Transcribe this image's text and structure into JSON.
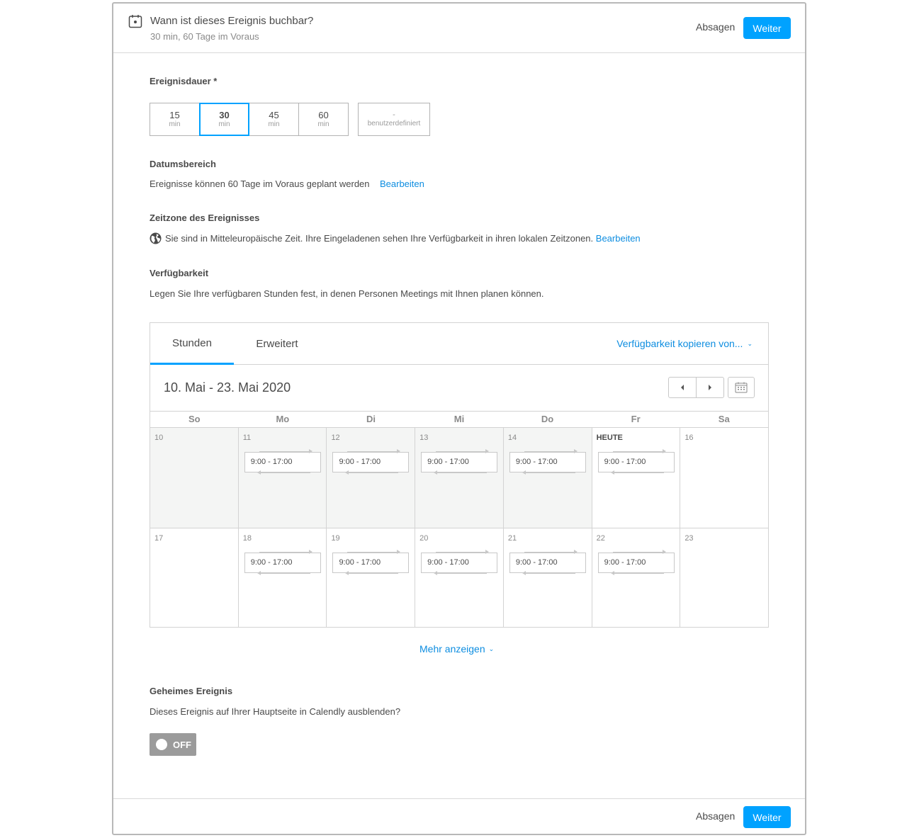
{
  "header": {
    "title": "Wann ist dieses Ereignis buchbar?",
    "subtitle": "30 min, 60 Tage im Voraus",
    "cancel_label": "Absagen",
    "next_label": "Weiter"
  },
  "duration": {
    "label": "Ereignisdauer *",
    "options": [
      {
        "value": "15",
        "unit": "min"
      },
      {
        "value": "30",
        "unit": "min"
      },
      {
        "value": "45",
        "unit": "min"
      },
      {
        "value": "60",
        "unit": "min"
      }
    ],
    "selected": "30",
    "custom": {
      "value": "-",
      "unit": "benutzerdefiniert"
    }
  },
  "date_range": {
    "label": "Datumsbereich",
    "text": "Ereignisse können 60 Tage im Voraus geplant werden",
    "edit_label": "Bearbeiten"
  },
  "timezone": {
    "label": "Zeitzone des Ereignisses",
    "text": "Sie sind in Mitteleuropäische Zeit. Ihre Eingeladenen sehen Ihre Verfügbarkeit in ihren lokalen Zeitzonen.",
    "edit_label": "Bearbeiten",
    "icon": "globe-icon"
  },
  "availability": {
    "label": "Verfügbarkeit",
    "text": "Legen Sie Ihre verfügbaren Stunden fest, in denen Personen Meetings mit Ihnen planen können."
  },
  "calendar": {
    "tabs": [
      "Stunden",
      "Erweitert"
    ],
    "active_tab": "Stunden",
    "copy_label": "Verfügbarkeit kopieren von...",
    "range": "10. Mai - 23. Mai 2020",
    "weekdays": [
      "So",
      "Mo",
      "Di",
      "Mi",
      "Do",
      "Fr",
      "Sa"
    ],
    "weeks": [
      [
        {
          "num": "10",
          "past": true,
          "slot": ""
        },
        {
          "num": "11",
          "past": true,
          "slot": "9:00 - 17:00"
        },
        {
          "num": "12",
          "past": true,
          "slot": "9:00 - 17:00"
        },
        {
          "num": "13",
          "past": true,
          "slot": "9:00 - 17:00"
        },
        {
          "num": "14",
          "past": true,
          "slot": "9:00 - 17:00"
        },
        {
          "num": "HEUTE",
          "past": false,
          "today": true,
          "slot": "9:00 - 17:00"
        },
        {
          "num": "16",
          "past": false,
          "slot": ""
        }
      ],
      [
        {
          "num": "17",
          "past": false,
          "slot": ""
        },
        {
          "num": "18",
          "past": false,
          "slot": "9:00 - 17:00"
        },
        {
          "num": "19",
          "past": false,
          "slot": "9:00 - 17:00"
        },
        {
          "num": "20",
          "past": false,
          "slot": "9:00 - 17:00"
        },
        {
          "num": "21",
          "past": false,
          "slot": "9:00 - 17:00"
        },
        {
          "num": "22",
          "past": false,
          "slot": "9:00 - 17:00"
        },
        {
          "num": "23",
          "past": false,
          "slot": ""
        }
      ]
    ],
    "more_label": "Mehr anzeigen"
  },
  "secret": {
    "label": "Geheimes Ereignis",
    "text": "Dieses Ereignis auf Ihrer Hauptseite in Calendly ausblenden?",
    "toggle_label": "OFF"
  },
  "colors": {
    "accent": "#00a2ff",
    "link": "#0d8de0",
    "past_day": "#f4f5f4",
    "toggle_off": "#9b9b9b"
  }
}
